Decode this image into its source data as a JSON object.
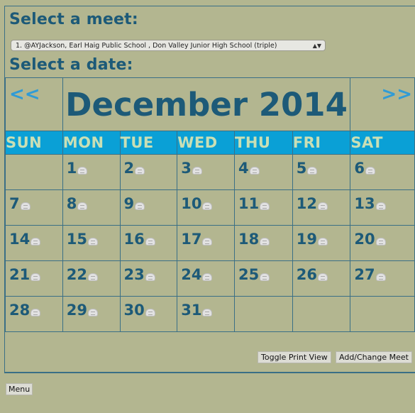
{
  "headings": {
    "select_meet": "Select a meet:",
    "select_date": "Select a date:"
  },
  "meet_select": {
    "selected": "1. @AYJackson, Earl Haig Public School , Don Valley Junior High School (triple)"
  },
  "calendar": {
    "month_title": "December 2014",
    "prev_label": "<<",
    "next_label": ">>",
    "day_names": [
      "SUN",
      "MON",
      "TUE",
      "WED",
      "THU",
      "FRI",
      "SAT"
    ],
    "weeks": [
      [
        "",
        "1",
        "2",
        "3",
        "4",
        "5",
        "6"
      ],
      [
        "7",
        "8",
        "9",
        "10",
        "11",
        "12",
        "13"
      ],
      [
        "14",
        "15",
        "16",
        "17",
        "18",
        "19",
        "20"
      ],
      [
        "21",
        "22",
        "23",
        "24",
        "25",
        "26",
        "27"
      ],
      [
        "28",
        "29",
        "30",
        "31",
        "",
        "",
        ""
      ]
    ]
  },
  "buttons": {
    "toggle_print": "Toggle Print View",
    "add_change_meet": "Add/Change Meet",
    "menu": "Menu"
  },
  "colors": {
    "background": "#b3b690",
    "header_bar": "#0aa0d6",
    "text": "#1d5a78",
    "nav_link": "#2f9bd6"
  },
  "icons": {
    "day_icon": "calendar-event-icon"
  }
}
